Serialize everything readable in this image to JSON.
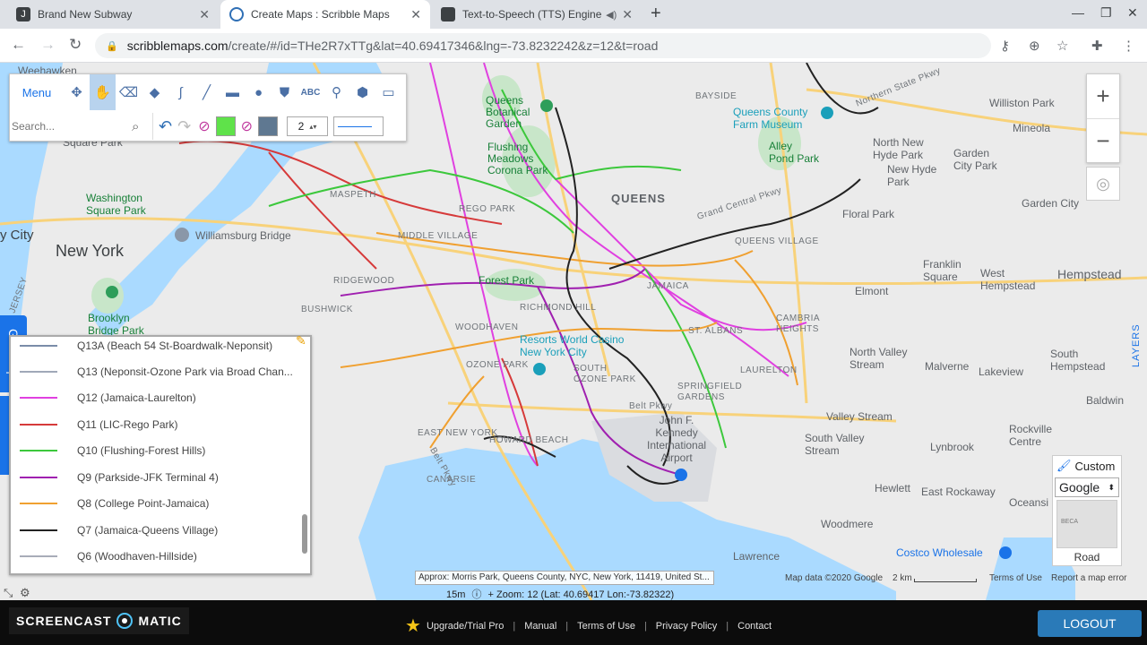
{
  "browser": {
    "tabs": [
      {
        "title": "Brand New Subway",
        "color": "#1a73e8"
      },
      {
        "title": "Create Maps : Scribble Maps",
        "color": "#2f6fb5"
      },
      {
        "title": "Text-to-Speech (TTS) Engine",
        "color": "#555555"
      }
    ],
    "url_host": "scribblemaps.com",
    "url_path": "/create/#/id=THe2R7xTTg&lat=40.69417346&lng=-73.8232242&z=12&t=road"
  },
  "toolbar": {
    "menu_label": "Menu",
    "search_placeholder": "Search...",
    "line_width": "2",
    "fill_color": "#5fe24a",
    "stroke_color": "#5f7891"
  },
  "side_tabs": {
    "help": "Get Help",
    "feedback": "Feedback"
  },
  "legend": {
    "items": [
      {
        "label": "Q13A (Beach 54 St-Boardwalk-Neponsit)",
        "color": "#7a8ca8"
      },
      {
        "label": "Q13 (Neponsit-Ozone Park via Broad Chan...",
        "color": "#a0a8b8"
      },
      {
        "label": "Q12 (Jamaica-Laurelton)",
        "color": "#e040e0"
      },
      {
        "label": "Q11 (LIC-Rego Park)",
        "color": "#d63a3a"
      },
      {
        "label": "Q10 (Flushing-Forest Hills)",
        "color": "#3cc83c"
      },
      {
        "label": "Q9 (Parkside-JFK Terminal 4)",
        "color": "#a020b0"
      },
      {
        "label": "Q8 (College Point-Jamaica)",
        "color": "#f0a030"
      },
      {
        "label": "Q7 (Jamaica-Queens Village)",
        "color": "#222222"
      },
      {
        "label": "Q6 (Woodhaven-Hillside)",
        "color": "#a8acb8"
      }
    ]
  },
  "map_labels": {
    "weehawken": "Weehawken",
    "square_park": "Square Park",
    "washington_sq": "Washington\nSquare Park",
    "city": "y City",
    "new_york": "New York",
    "williamsburg": "Williamsburg Bridge",
    "brooklyn_bridge": "Brooklyn\nBridge Park",
    "botanical": "Queens\nBotanical\nGarden",
    "flushing_meadows": "Flushing\nMeadows\nCorona Park",
    "queens": "QUEENS",
    "maspeth": "MASPETH",
    "rego_park": "REGO PARK",
    "middle_village": "MIDDLE VILLAGE",
    "ridgewood": "RIDGEWOOD",
    "bushwick": "BUSHWICK",
    "forest_park": "Forest Park",
    "richmond_hill": "RICHMOND HILL",
    "woodhaven": "WOODHAVEN",
    "ozone_park": "OZONE PARK",
    "resorts": "Resorts World Casino\nNew York City",
    "south_ozone": "SOUTH\nOZONE PARK",
    "jamaica": "JAMAICA",
    "st_albans": "ST. ALBANS",
    "cambria": "CAMBRIA\nHEIGHTS",
    "laurelton": "LAURELTON",
    "springfield": "SPRINGFIELD\nGARDENS",
    "queens_village": "QUEENS VILLAGE",
    "bayside": "BAYSIDE",
    "qc_farm": "Queens County\nFarm Museum",
    "alley_pond": "Alley\nPond Park",
    "williston": "Williston Park",
    "mineola": "Mineola",
    "nnhp": "North New\nHyde Park",
    "nhp": "New Hyde\nPark",
    "garden_city_park": "Garden\nCity Park",
    "floral_park": "Floral Park",
    "garden_city": "Garden City",
    "franklin_sq": "Franklin\nSquare",
    "west_hempstead": "West\nHempstead",
    "hempstead": "Hempstead",
    "elmont": "Elmont",
    "nvs": "North Valley\nStream",
    "malverne": "Malverne",
    "lakeview": "Lakeview",
    "south_hempstead": "South\nHempstead",
    "baldwin": "Baldwin",
    "valley_stream": "Valley Stream",
    "rockville": "Rockville\nCentre",
    "svs": "South Valley\nStream",
    "lynbrook": "Lynbrook",
    "hewlett": "Hewlett",
    "east_rockaway": "East Rockaway",
    "oceanside": "Oceansi",
    "woodmere": "Woodmere",
    "costco": "Costco Wholesale",
    "lawrence": "Lawrence",
    "jfk": "John F.\nKennedy\nInternational\nAirport",
    "belt_pkwy": "Belt Pkwy",
    "grand_central": "Grand Central Pkwy",
    "northern_state": "Northern State Pkwy",
    "east_new_york": "EAST NEW YORK",
    "canarsie": "CANARSIE",
    "howard_beach": "HOWARD BEACH",
    "belt_pkwy2": "Belt Pkwy",
    "jersey": "JERSEY"
  },
  "map_controls": {
    "zoom_in": "+",
    "zoom_out": "−",
    "layers": "LAYERS"
  },
  "maptype": {
    "custom": "Custom",
    "selected": "Google",
    "road": "Road",
    "thumb_label": "BECA"
  },
  "status": {
    "approx": "Approx: Morris Park, Queens County, NYC, New York, 11419, United St...",
    "time": "15m",
    "zoom_info": "Zoom: 12 (Lat: 40.69417 Lon:-73.82322)",
    "map_data": "Map data ©2020 Google",
    "scale": "2 km",
    "terms": "Terms of Use",
    "report": "Report a map error"
  },
  "footer": {
    "logo_left": "SCREENCAST",
    "logo_right": "MATIC",
    "upgrade": "Upgrade/Trial Pro",
    "manual": "Manual",
    "terms": "Terms of Use",
    "privacy": "Privacy Policy",
    "contact": "Contact",
    "logout": "LOGOUT"
  }
}
